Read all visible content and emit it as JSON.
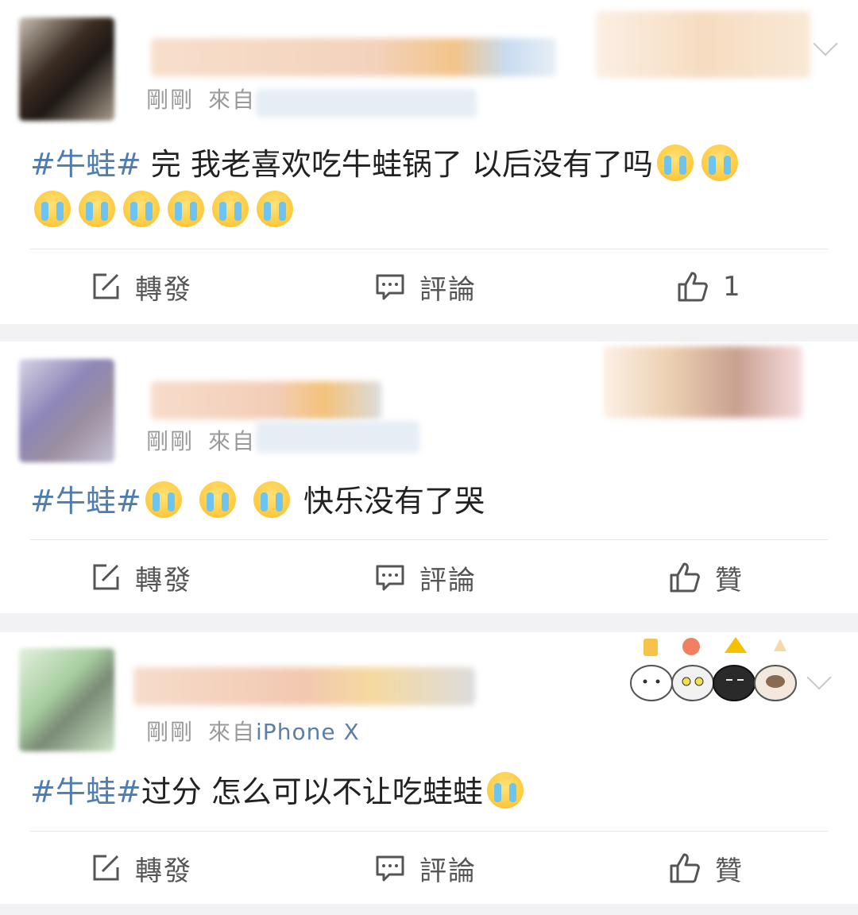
{
  "posts": [
    {
      "time": "剛剛",
      "source": "來自",
      "device": "",
      "content": {
        "hashtag": "#牛蛙#",
        "text": " 完 我老喜欢吃牛蛙锅了 以后没有了吗",
        "emoji_count": 8
      },
      "actions": {
        "repost": "轉發",
        "comment": "評論",
        "like": "1"
      }
    },
    {
      "time": "剛剛",
      "source": "來自",
      "device": "",
      "content": {
        "hashtag": "#牛蛙#",
        "text": "快乐没有了哭",
        "emoji_count": 3
      },
      "actions": {
        "repost": "轉發",
        "comment": "評論",
        "like": "贊"
      }
    },
    {
      "time": "剛剛",
      "source": "來自",
      "device": "iPhone X",
      "content": {
        "hashtag": "#牛蛙#",
        "text": "过分 怎么可以不让吃蛙蛙",
        "emoji_count": 1
      },
      "actions": {
        "repost": "轉發",
        "comment": "評論",
        "like": "贊"
      }
    }
  ],
  "icons": {
    "repost": "repost-icon",
    "comment": "comment-icon",
    "like": "thumbs-up-icon",
    "emoji": "crying-face-icon",
    "menu": "chevron-down-icon"
  },
  "colors": {
    "hashtag": "#507daf",
    "background": "#f2f2f4",
    "card": "#ffffff",
    "meta": "#9a9a9a"
  }
}
